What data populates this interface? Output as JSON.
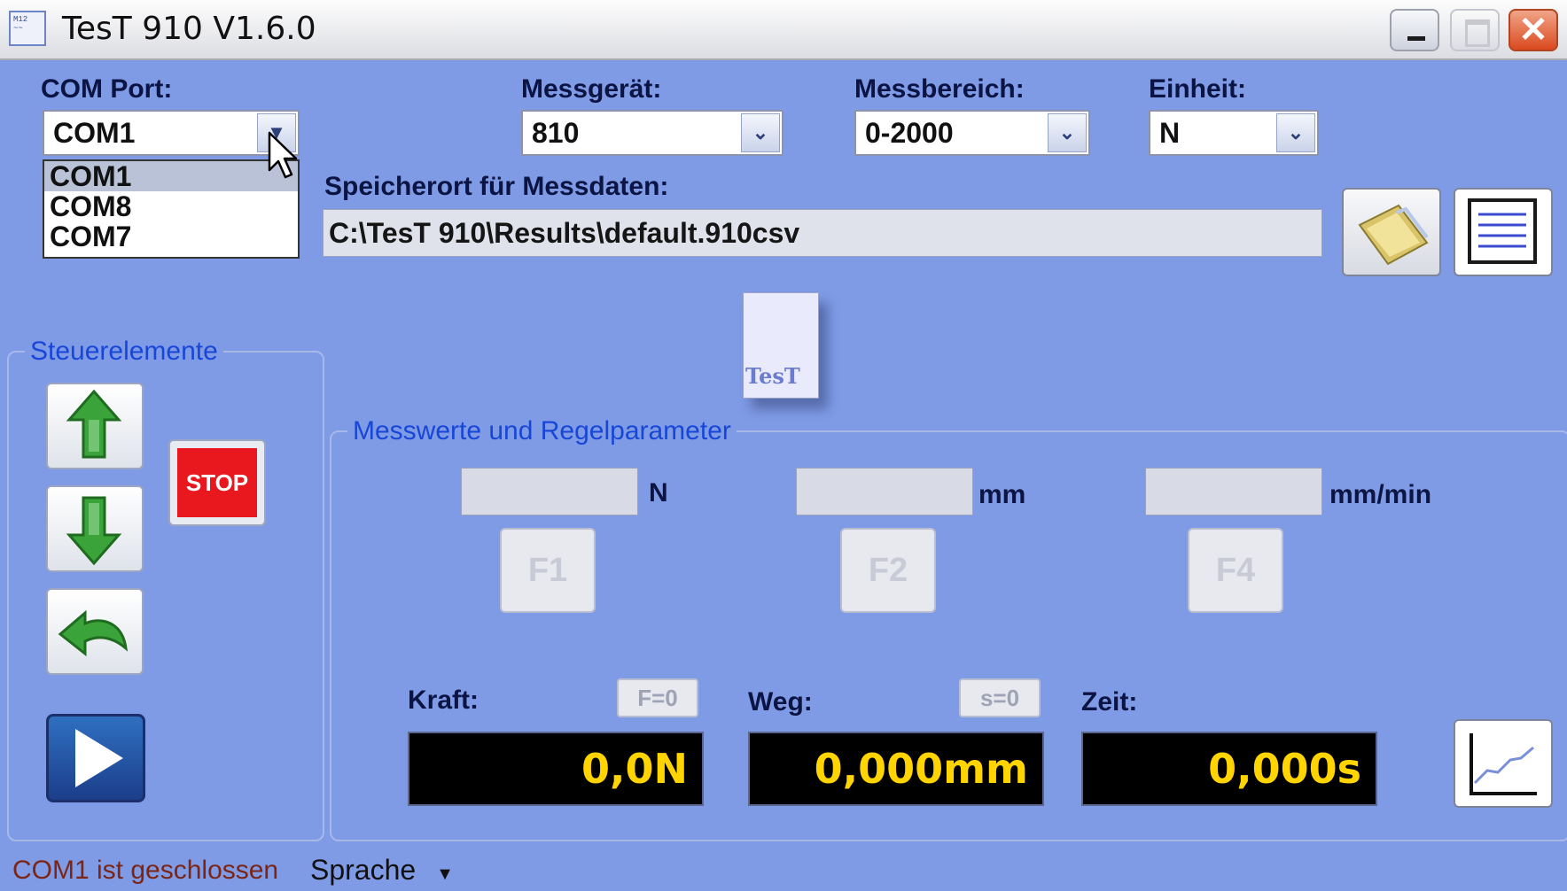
{
  "window": {
    "title": "TesT 910 V1.6.0",
    "app_icon_text": "M12 ~~"
  },
  "header": {
    "com_port": {
      "label": "COM Port:",
      "value": "COM1",
      "options": [
        "COM1",
        "COM8",
        "COM7"
      ],
      "selected_index": 0
    },
    "messgeraet": {
      "label": "Messgerät:",
      "value": "810"
    },
    "messbereich": {
      "label": "Messbereich:",
      "value": "0-2000"
    },
    "einheit": {
      "label": "Einheit:",
      "value": "N"
    },
    "speicherort": {
      "label": "Speicherort für Messdaten:",
      "path": "C:\\TesT 910\\Results\\default.910csv"
    },
    "logo_text": "TesT"
  },
  "controls": {
    "group_title": "Steuerelemente",
    "stop_label": "STOP"
  },
  "measurements": {
    "group_title": "Messwerte und Regelparameter",
    "force_unit": "N",
    "distance_unit": "mm",
    "speed_unit": "mm/min",
    "f1": "F1",
    "f2": "F2",
    "f4": "F4",
    "kraft_label": "Kraft:",
    "kraft_zero": "F=0",
    "kraft_value": "0,0N",
    "weg_label": "Weg:",
    "weg_zero": "s=0",
    "weg_value": "0,000mm",
    "zeit_label": "Zeit:",
    "zeit_value": "0,000s"
  },
  "statusbar": {
    "status": "COM1 ist geschlossen",
    "language": "Sprache"
  },
  "colors": {
    "background": "#7f9be6",
    "display_text": "#ffd400",
    "group_title": "#1847d8",
    "stop": "#e8181e"
  }
}
